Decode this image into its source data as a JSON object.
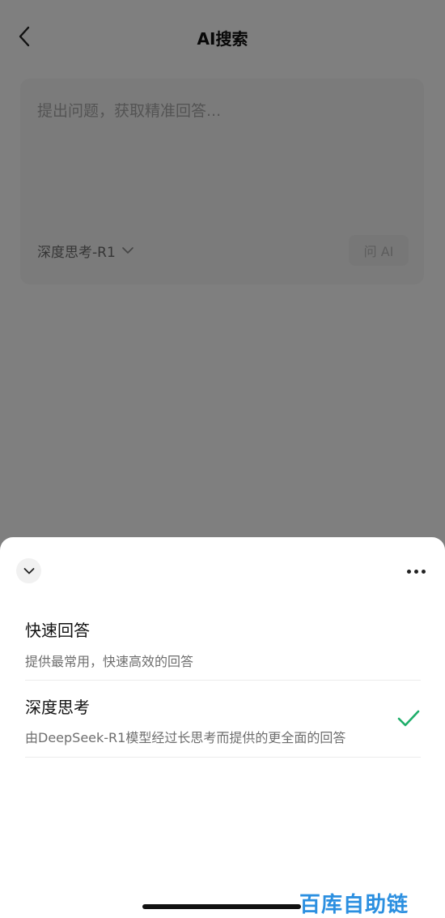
{
  "nav": {
    "title": "AI搜索"
  },
  "search": {
    "placeholder": "提出问题，获取精准回答...",
    "value": "",
    "mode_label": "深度思考-R1",
    "ask_label": "问 AI"
  },
  "sheet": {
    "options": [
      {
        "title": "快速回答",
        "description": "提供最常用，快速高效的回答",
        "selected": false
      },
      {
        "title": "深度思考",
        "description": "由DeepSeek-R1模型经过长思考而提供的更全面的回答",
        "selected": true
      }
    ]
  },
  "watermark": {
    "text": "百库自助链"
  },
  "colors": {
    "accent_check": "#1fae6a",
    "overlay": "rgba(0,0,0,0.5)",
    "watermark": "#2b8fe0"
  },
  "icons": [
    "back-chevron-icon",
    "chevron-down-icon",
    "more-dots-icon",
    "checkmark-icon"
  ]
}
